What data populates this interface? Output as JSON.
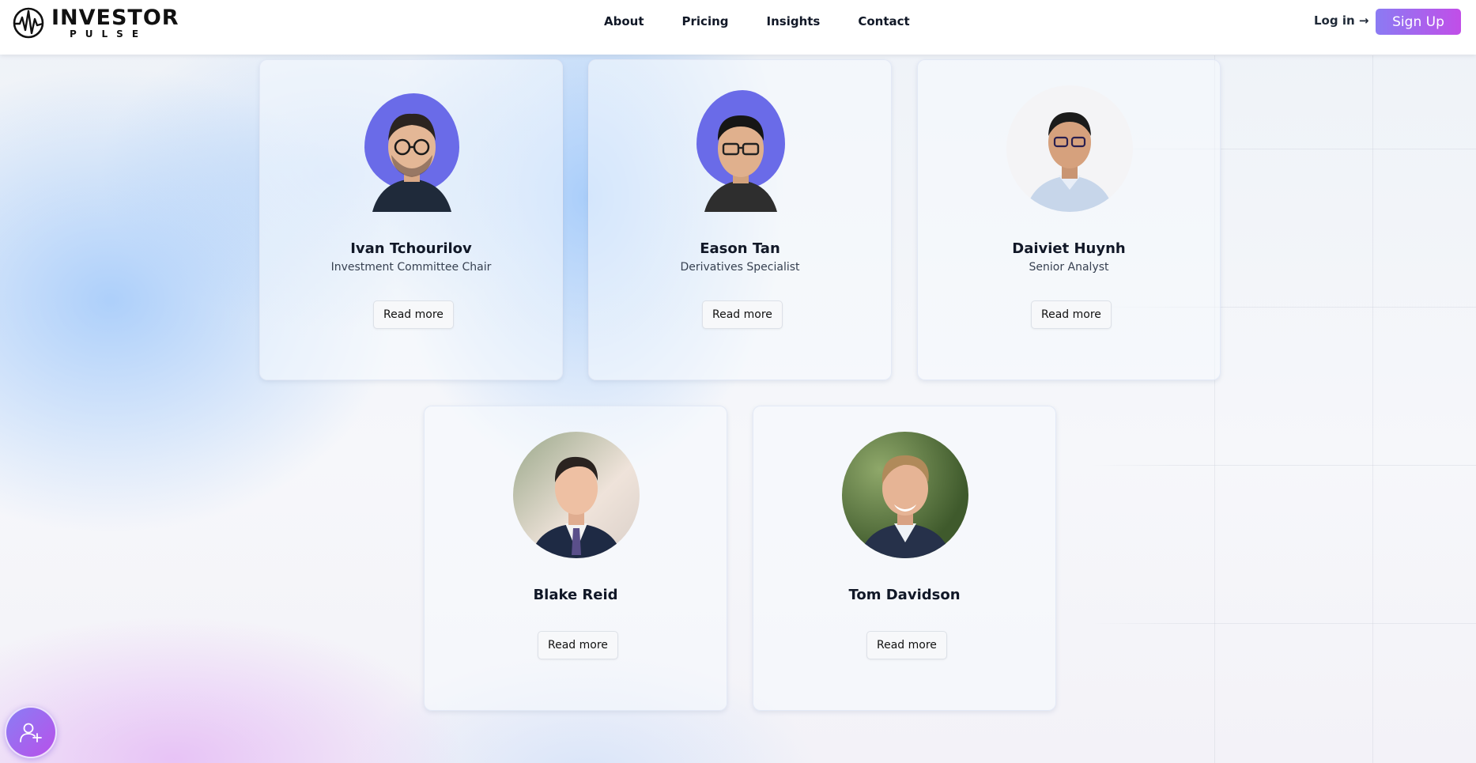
{
  "brand": {
    "name": "INVESTOR",
    "sub": "PULSE"
  },
  "nav": {
    "links": [
      "About",
      "Pricing",
      "Insights",
      "Contact"
    ],
    "login_label": "Log in →",
    "signup_label": "Sign Up"
  },
  "team": [
    {
      "name": "Ivan Tchourilov",
      "title": "Investment Committee Chair",
      "button": "Read more",
      "avatar": "portrait-with-purple-blob"
    },
    {
      "name": "Eason Tan",
      "title": "Derivatives Specialist",
      "button": "Read more",
      "avatar": "portrait-with-purple-blob"
    },
    {
      "name": "Daiviet Huynh",
      "title": "Senior Analyst",
      "button": "Read more",
      "avatar": "portrait-circle"
    },
    {
      "name": "Blake Reid",
      "title": "",
      "button": "Read more",
      "avatar": "portrait-circle"
    },
    {
      "name": "Tom Davidson",
      "title": "",
      "button": "Read more",
      "avatar": "portrait-circle"
    }
  ],
  "fab": {
    "icon": "add-user-icon"
  },
  "colors": {
    "accent_start": "#8b7bf3",
    "accent_end": "#c14ee8",
    "blob": "#6a6be8"
  }
}
